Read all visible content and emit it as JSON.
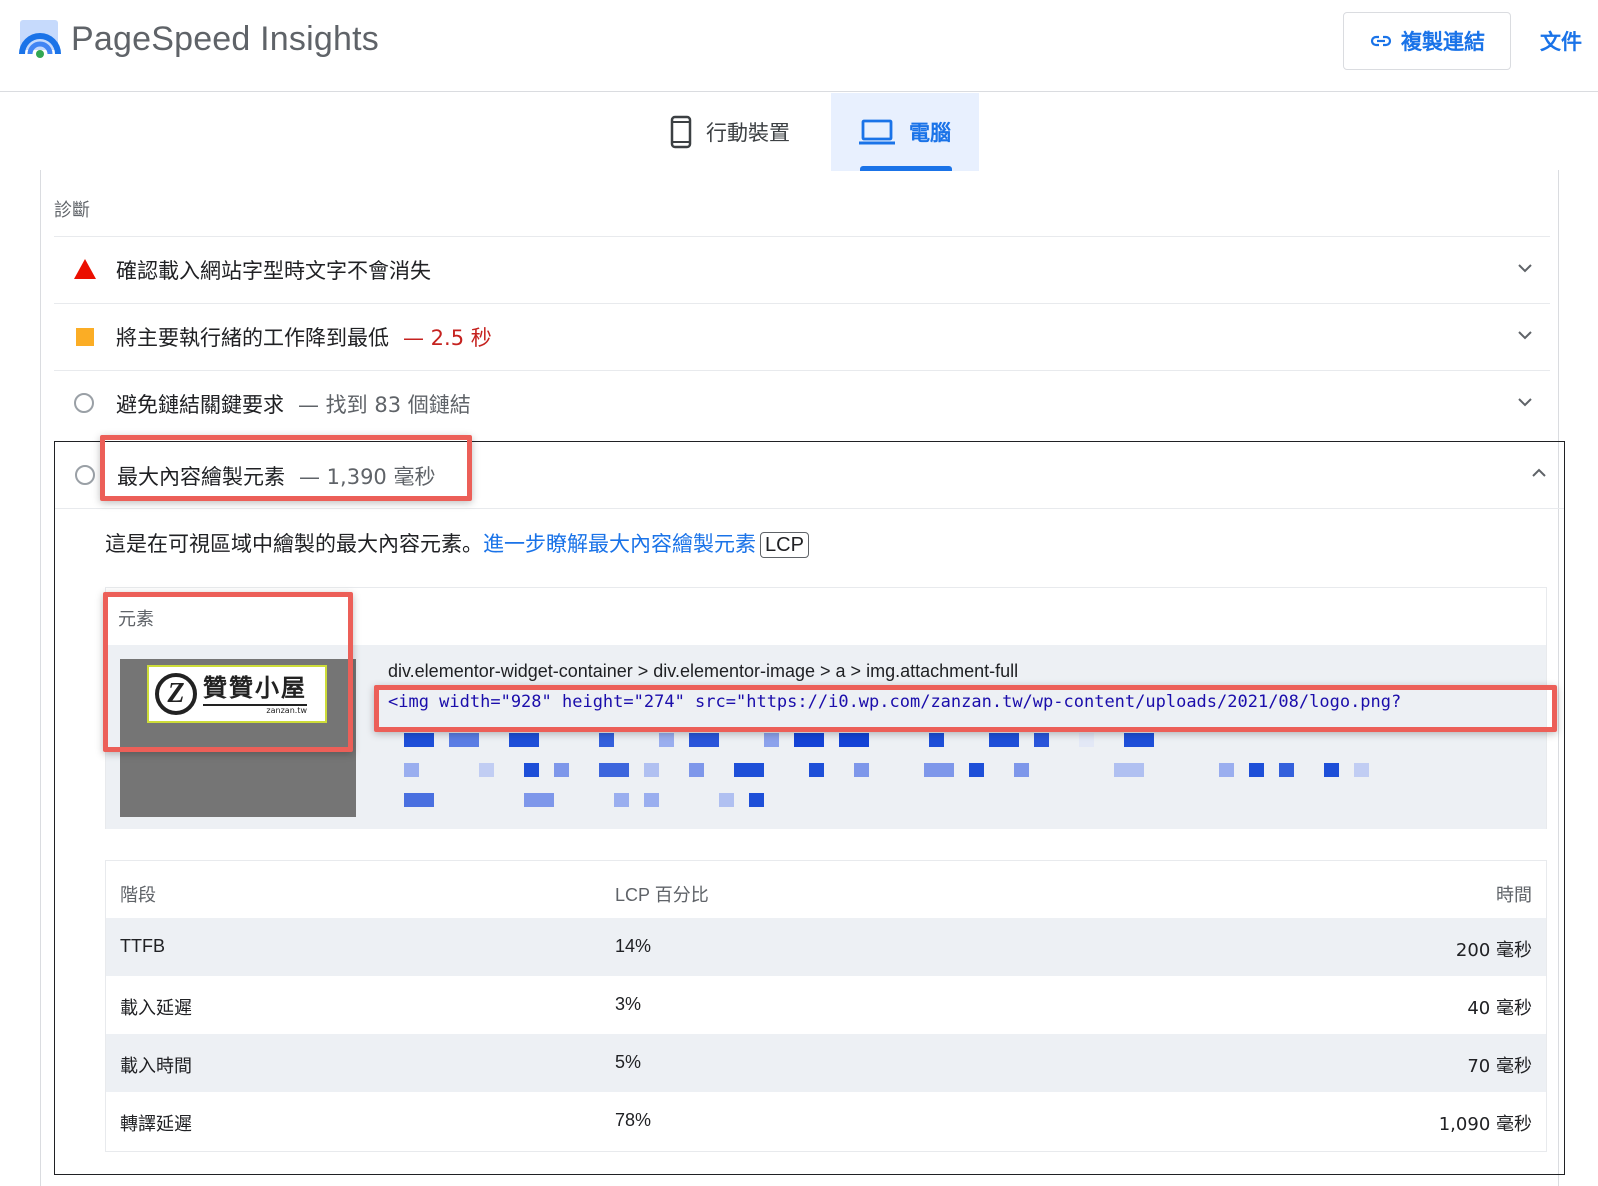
{
  "app": {
    "title": "PageSpeed Insights"
  },
  "header": {
    "copy_link_label": "複製連結",
    "docs_label": "文件"
  },
  "tabs": [
    {
      "label": "行動裝置",
      "selected": false
    },
    {
      "label": "電腦",
      "selected": true
    }
  ],
  "section": {
    "title": "診斷"
  },
  "audits": [
    {
      "title": "確認載入網站字型時文字不會消失",
      "detail": "",
      "status": "fail"
    },
    {
      "title": "將主要執行緒的工作降到最低",
      "detail": "— 2.5 秒",
      "status": "average"
    },
    {
      "title": "避免鏈結關鍵要求",
      "detail": "— 找到 83 個鏈結",
      "status": "info"
    },
    {
      "title": "最大內容繪製元素",
      "detail": "— 1,390 毫秒",
      "status": "info",
      "expanded": true
    }
  ],
  "lcp": {
    "description": "這是在可視區域中繪製的最大內容元素。",
    "learn_more": "進一步瞭解最大內容繪製元素",
    "badge": "LCP",
    "element_header": "元素",
    "selector": "div.elementor-widget-container > div.elementor-image > a > img.attachment-full",
    "snippet": "<img width=\"928\" height=\"274\" src=\"https://i0.wp.com/zanzan.tw/wp-content/uploads/2021/08/logo.png?",
    "thumbnail": {
      "logo_text": "贊贊小屋",
      "logo_sub": "zanzan.tw",
      "logo_mark": "Z"
    }
  },
  "phases": {
    "headers": {
      "phase": "階段",
      "percent": "LCP 百分比",
      "time": "時間"
    },
    "rows": [
      {
        "phase": "TTFB",
        "percent": "14%",
        "time": "200 毫秒"
      },
      {
        "phase": "載入延遲",
        "percent": "3%",
        "time": "40 毫秒"
      },
      {
        "phase": "載入時間",
        "percent": "5%",
        "time": "70 毫秒"
      },
      {
        "phase": "轉譯延遲",
        "percent": "78%",
        "time": "1,090 毫秒"
      }
    ]
  },
  "colors": {
    "accent": "#1a73e8",
    "fail": "#eb0f00",
    "average": "#fbad25",
    "highlight": "#ec5f58"
  }
}
